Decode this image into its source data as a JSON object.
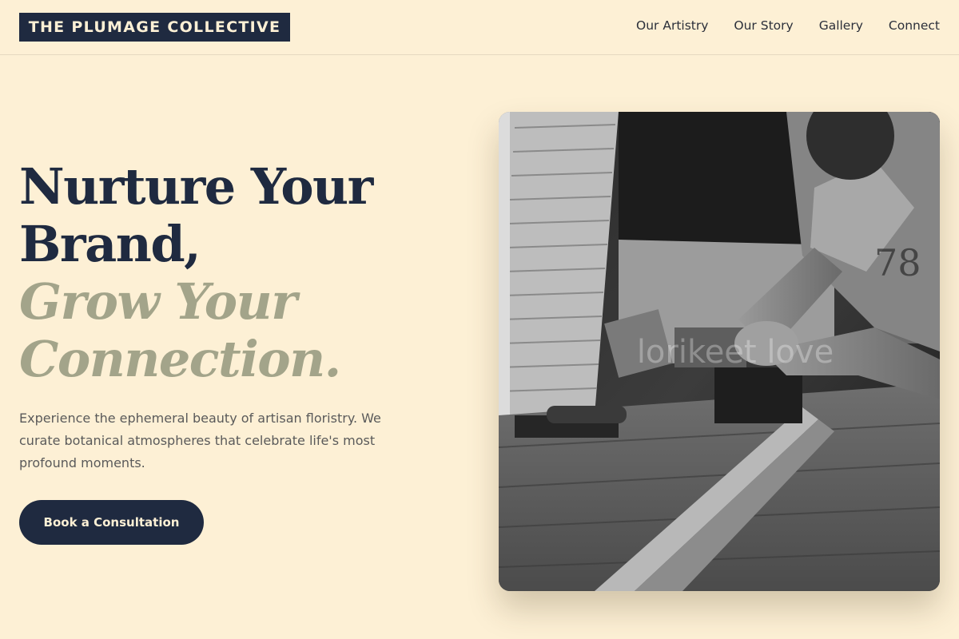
{
  "brand": {
    "name": "THE PLUMAGE COLLECTIVE"
  },
  "nav": {
    "items": [
      {
        "label": "Our Artistry"
      },
      {
        "label": "Our Story"
      },
      {
        "label": "Gallery"
      },
      {
        "label": "Connect"
      }
    ]
  },
  "hero": {
    "headline_line1": "Nurture Your",
    "headline_line2": "Brand,",
    "headline_line3": "Grow Your",
    "headline_line4": "Connection.",
    "description": "Experience the ephemeral beauty of artisan floristry. We curate botanical atmospheres that celebrate life's most profound moments.",
    "cta_label": "Book a Consultation"
  },
  "image": {
    "watermark": "lorikeet love"
  },
  "colors": {
    "background": "#fdf0d5",
    "navy": "#1f2a40",
    "sage": "#a3a48a",
    "body_text": "#5a5a5a"
  }
}
